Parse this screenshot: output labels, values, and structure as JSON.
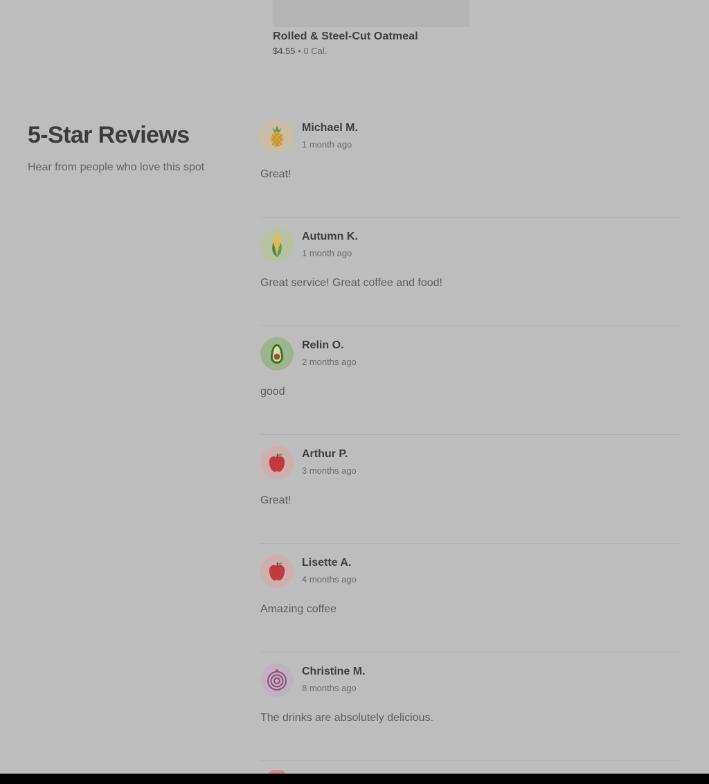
{
  "menu_item": {
    "name": "Rolled & Steel-Cut Oatmeal",
    "price": "$4.55",
    "separator": "•",
    "calories": "0 Cal."
  },
  "reviews_section": {
    "title": "5-Star Reviews",
    "subtitle": "Hear from people who love this spot"
  },
  "reviews": [
    {
      "name": "Michael M.",
      "date": "1 month ago",
      "text": "Great!",
      "avatar_icon": "pineapple-icon"
    },
    {
      "name": "Autumn K.",
      "date": "1 month ago",
      "text": "Great service! Great coffee and food!",
      "avatar_icon": "corn-icon"
    },
    {
      "name": "Relin O.",
      "date": "2 months ago",
      "text": "good",
      "avatar_icon": "avocado-icon"
    },
    {
      "name": "Arthur P.",
      "date": "3 months ago",
      "text": "Great!",
      "avatar_icon": "apple-icon"
    },
    {
      "name": "Lisette A.",
      "date": "4 months ago",
      "text": "Amazing coffee",
      "avatar_icon": "apple-icon"
    },
    {
      "name": "Christine M.",
      "date": "8 months ago",
      "text": "The drinks are absolutely delicious.",
      "avatar_icon": "onion-icon"
    }
  ],
  "colors": {
    "overlay_background": "#bdbdbd",
    "heading_text": "#3c3c3c",
    "secondary_text": "#666666",
    "divider": "#b0b0b0"
  }
}
